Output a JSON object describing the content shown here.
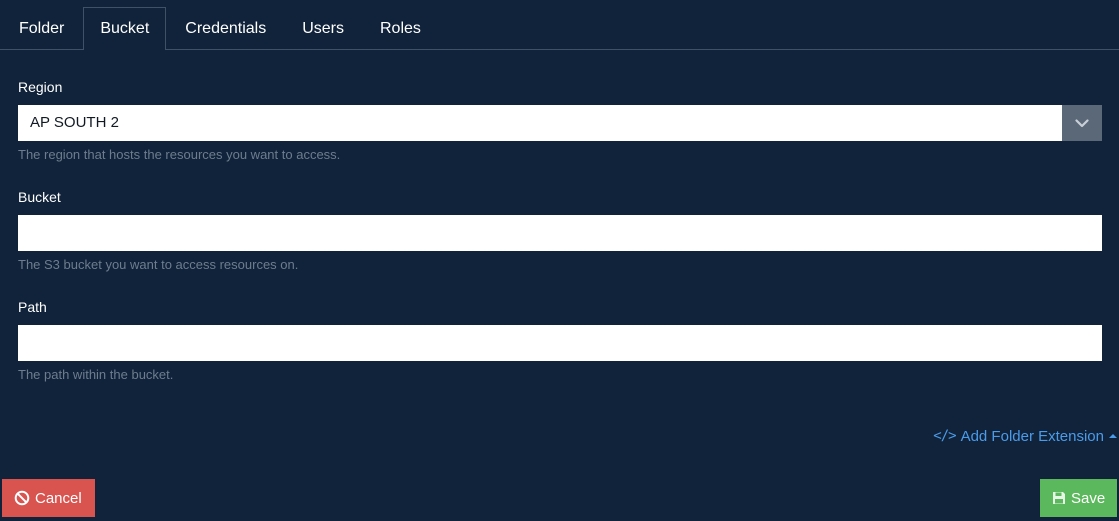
{
  "tabs": [
    {
      "label": "Folder",
      "active": false
    },
    {
      "label": "Bucket",
      "active": true
    },
    {
      "label": "Credentials",
      "active": false
    },
    {
      "label": "Users",
      "active": false
    },
    {
      "label": "Roles",
      "active": false
    }
  ],
  "fields": {
    "region": {
      "label": "Region",
      "value": "AP SOUTH 2",
      "help": "The region that hosts the resources you want to access."
    },
    "bucket": {
      "label": "Bucket",
      "value": "",
      "help": "The S3 bucket you want to access resources on."
    },
    "path": {
      "label": "Path",
      "value": "",
      "help": "The path within the bucket."
    }
  },
  "extension_link": {
    "label": "Add Folder Extension",
    "icon": "code-icon"
  },
  "buttons": {
    "cancel": {
      "label": "Cancel",
      "icon": "ban-icon",
      "color": "#d9534f"
    },
    "save": {
      "label": "Save",
      "icon": "floppy-disk-icon",
      "color": "#5cb85c"
    }
  },
  "colors": {
    "background": "#11233a",
    "link": "#4a9bea",
    "help_text": "#6d7d8e"
  }
}
